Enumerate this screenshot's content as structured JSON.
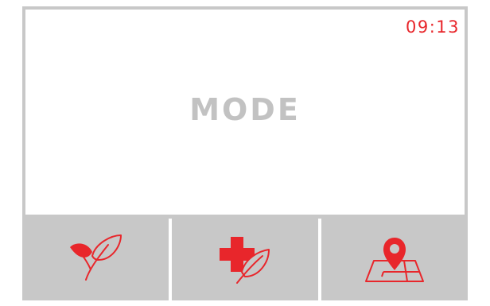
{
  "header": {
    "time": "09:13"
  },
  "main": {
    "title": "MODE"
  },
  "modes": [
    {
      "name": "eco",
      "icon": "plant-leaves-icon"
    },
    {
      "name": "health",
      "icon": "medical-cross-leaf-icon"
    },
    {
      "name": "location",
      "icon": "map-pin-icon"
    }
  ],
  "colors": {
    "accent": "#e8262b",
    "panel": "#c8c8c8",
    "title_text": "#c2c2c2",
    "screen_bg": "#ffffff"
  }
}
